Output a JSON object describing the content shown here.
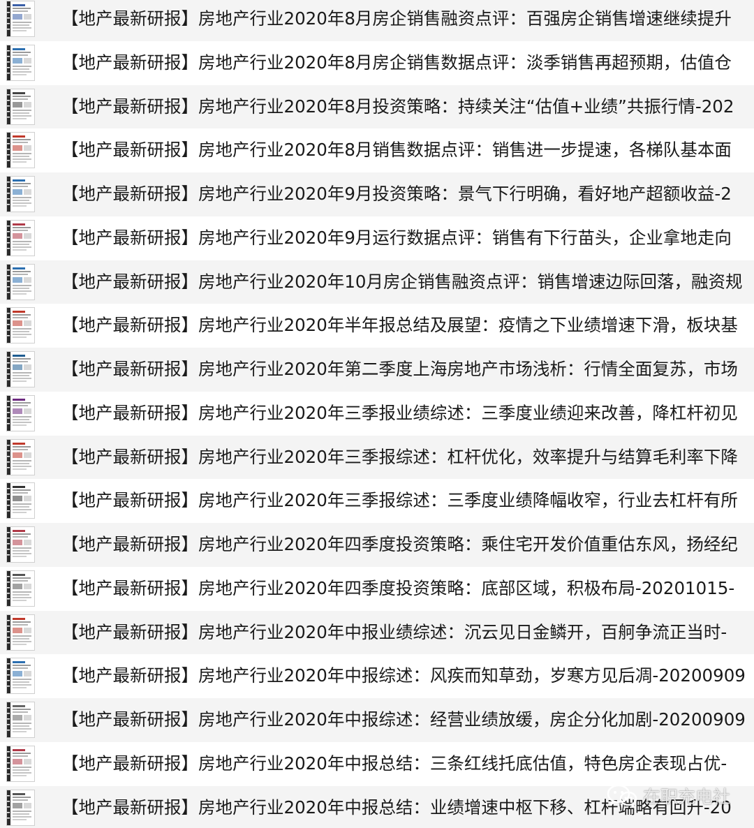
{
  "files": [
    {
      "name": "【地产最新研报】房地产行业2020年8月房企销售融资点评：百强房企销售增速继续提升",
      "thumb": "report-thumb-icon"
    },
    {
      "name": "【地产最新研报】房地产行业2020年8月房企销售数据点评：淡季销售再超预期，估值仓",
      "thumb": "report-thumb-icon"
    },
    {
      "name": "【地产最新研报】房地产行业2020年8月投资策略：持续关注“估值+业绩”共振行情-202",
      "thumb": "report-thumb-icon"
    },
    {
      "name": "【地产最新研报】房地产行业2020年8月销售数据点评：销售进一步提速，各梯队基本面",
      "thumb": "report-thumb-icon"
    },
    {
      "name": "【地产最新研报】房地产行业2020年9月投资策略：景气下行明确，看好地产超额收益-2",
      "thumb": "report-thumb-icon"
    },
    {
      "name": "【地产最新研报】房地产行业2020年9月运行数据点评：销售有下行苗头，企业拿地走向",
      "thumb": "report-thumb-icon"
    },
    {
      "name": "【地产最新研报】房地产行业2020年10月房企销售融资点评：销售增速边际回落，融资规",
      "thumb": "report-thumb-icon"
    },
    {
      "name": "【地产最新研报】房地产行业2020年半年报总结及展望：疫情之下业绩增速下滑，板块基",
      "thumb": "report-thumb-icon"
    },
    {
      "name": "【地产最新研报】房地产行业2020年第二季度上海房地产市场浅析：行情全面复苏，市场",
      "thumb": "report-thumb-icon"
    },
    {
      "name": "【地产最新研报】房地产行业2020年三季报业绩综述：三季度业绩迎来改善，降杠杆初见",
      "thumb": "report-thumb-icon"
    },
    {
      "name": "【地产最新研报】房地产行业2020年三季报综述：杠杆优化，效率提升与结算毛利率下降",
      "thumb": "report-thumb-icon"
    },
    {
      "name": "【地产最新研报】房地产行业2020年三季报综述：三季度业绩降幅收窄，行业去杠杆有所",
      "thumb": "report-thumb-icon"
    },
    {
      "name": "【地产最新研报】房地产行业2020年四季度投资策略：乘住宅开发价值重估东风，扬经纪",
      "thumb": "report-thumb-icon"
    },
    {
      "name": "【地产最新研报】房地产行业2020年四季度投资策略：底部区域，积极布局-20201015-",
      "thumb": "report-thumb-icon"
    },
    {
      "name": "【地产最新研报】房地产行业2020年中报业绩综述：沉云见日金鳞开，百舸争流正当时-",
      "thumb": "report-thumb-icon"
    },
    {
      "name": "【地产最新研报】房地产行业2020年中报综述：风疾而知草劲，岁寒方见后凋-20200909",
      "thumb": "report-thumb-icon"
    },
    {
      "name": "【地产最新研报】房地产行业2020年中报综述：经营业绩放缓，房企分化加剧-20200909",
      "thumb": "report-thumb-icon"
    },
    {
      "name": "【地产最新研报】房地产行业2020年中报总结：三条红线托底估值，特色房企表现占优-",
      "thumb": "report-thumb-icon"
    },
    {
      "name": "【地产最新研报】房地产行业2020年中报总结：业绩增速中枢下移、杠杆端略有回升-20",
      "thumb": "report-thumb-icon"
    }
  ],
  "watermark": {
    "text": "在职充电社",
    "icon": "wechat-icon"
  },
  "colors": {
    "row_alt_background": "#f4f4f4",
    "text": "#1a1a1a"
  }
}
